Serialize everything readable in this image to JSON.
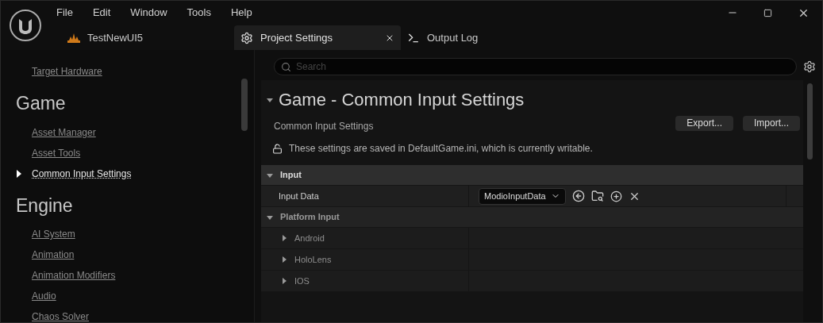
{
  "menu": [
    "File",
    "Edit",
    "Window",
    "Tools",
    "Help"
  ],
  "tabs": [
    {
      "label": "TestNewUI5",
      "kind": "project",
      "selected": false,
      "closable": false
    },
    {
      "label": "Project Settings",
      "kind": "settings",
      "selected": true,
      "closable": true
    },
    {
      "label": "Output Log",
      "kind": "log",
      "selected": false,
      "closable": false
    }
  ],
  "sidebar": {
    "sections": [
      {
        "items": [
          {
            "label": "Target Hardware",
            "selected": false
          }
        ]
      },
      {
        "title": "Game",
        "items": [
          {
            "label": "Asset Manager",
            "selected": false
          },
          {
            "label": "Asset Tools",
            "selected": false
          },
          {
            "label": "Common Input Settings",
            "selected": true
          }
        ]
      },
      {
        "title": "Engine",
        "items": [
          {
            "label": "AI System",
            "selected": false
          },
          {
            "label": "Animation",
            "selected": false
          },
          {
            "label": "Animation Modifiers",
            "selected": false
          },
          {
            "label": "Audio",
            "selected": false
          },
          {
            "label": "Chaos Solver",
            "selected": false
          }
        ]
      }
    ]
  },
  "search": {
    "placeholder": "Search"
  },
  "header": {
    "title": "Game - Common Input Settings",
    "subtitle": "Common Input Settings",
    "buttons": [
      "Export...",
      "Import..."
    ],
    "notice": "These settings are saved in DefaultGame.ini, which is currently writable."
  },
  "categories": [
    {
      "label": "Input",
      "expanded": true,
      "rows": [
        {
          "label": "Input Data",
          "value": "ModioInputData"
        }
      ]
    },
    {
      "label": "Platform Input",
      "expanded": true,
      "children": [
        {
          "label": "Android",
          "expanded": false
        },
        {
          "label": "HoloLens",
          "expanded": false
        },
        {
          "label": "IOS",
          "expanded": false
        }
      ]
    }
  ]
}
